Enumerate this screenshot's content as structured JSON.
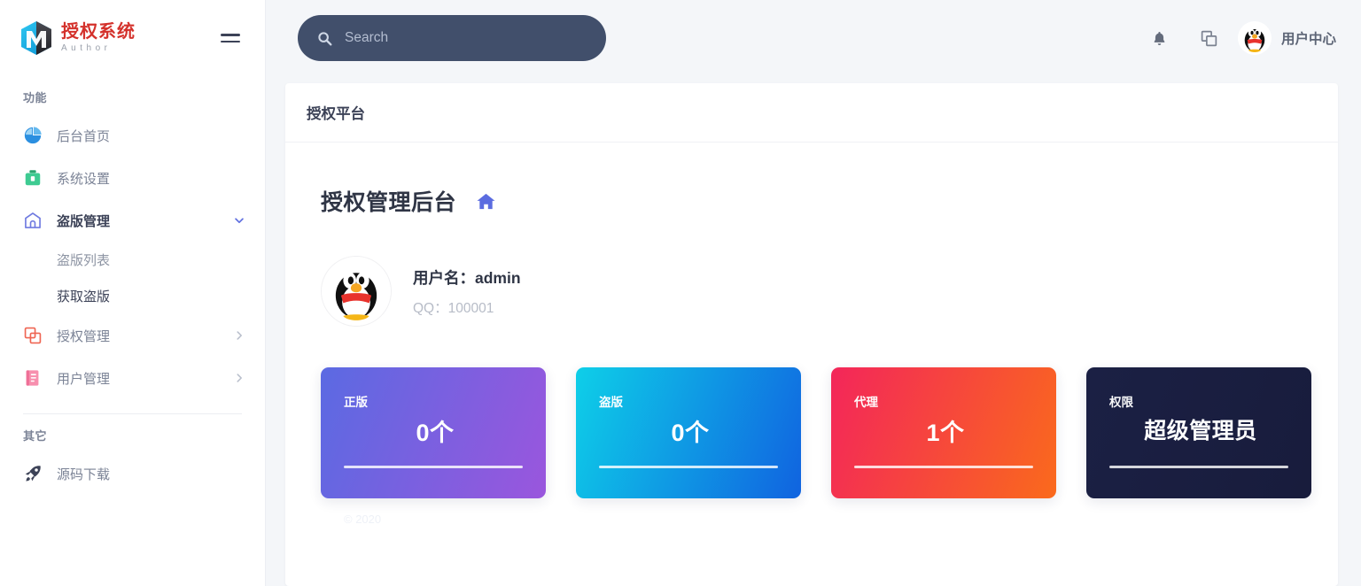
{
  "brand": {
    "title": "授权系统",
    "subtitle": "Author",
    "logo_icon": "cube-m-logo-icon",
    "menu_toggle_icon": "hamburger-icon"
  },
  "sidebar": {
    "sections": [
      {
        "title": "功能"
      },
      {
        "title": "其它"
      }
    ],
    "items": [
      {
        "label": "后台首页",
        "icon": "pie-chart-icon",
        "icon_color": "#2b8fe0",
        "expandable": false
      },
      {
        "label": "系统设置",
        "icon": "toolbox-icon",
        "icon_color": "#37c18a",
        "expandable": false
      },
      {
        "label": "盗版管理",
        "icon": "store-icon",
        "icon_color": "#6f7ae0",
        "expandable": true,
        "expanded": true,
        "active": true
      },
      {
        "label": "授权管理",
        "icon": "copy-squares-icon",
        "icon_color": "#ef6552",
        "expandable": true,
        "expanded": false
      },
      {
        "label": "用户管理",
        "icon": "document-lines-icon",
        "icon_color": "#ef7c9e",
        "expandable": true,
        "expanded": false
      }
    ],
    "subitems": [
      {
        "label": "盗版列表",
        "current": false
      },
      {
        "label": "获取盗版",
        "current": true
      }
    ],
    "other_items": [
      {
        "label": "源码下载",
        "icon": "rocket-icon",
        "icon_color": "#3c4257"
      }
    ],
    "caret_down_icon": "chevron-down-icon",
    "caret_right_icon": "chevron-right-icon"
  },
  "topbar": {
    "search": {
      "placeholder": "Search",
      "value": "",
      "icon": "search-icon"
    },
    "notification_icon": "bell-icon",
    "windows_icon": "copy-windows-icon",
    "avatar_icon": "qq-penguin-avatar-icon",
    "user_center_label": "用户中心"
  },
  "panel": {
    "header_title": "授权平台",
    "dashboard_title": "授权管理后台",
    "home_icon": "home-icon",
    "user": {
      "avatar_icon": "qq-penguin-avatar-icon",
      "name_label": "用户名：",
      "name_value": "admin",
      "qq_label": "QQ：",
      "qq_value": "100001"
    },
    "cards": [
      {
        "label": "正版",
        "value": "0个",
        "gradient_from": "#5b6ae2",
        "gradient_to": "#9a56dd"
      },
      {
        "label": "盗版",
        "value": "0个",
        "gradient_from": "#0ecfe8",
        "gradient_to": "#1063e0"
      },
      {
        "label": "代理",
        "value": "1个",
        "gradient_from": "#f3265a",
        "gradient_to": "#fa6a1c"
      },
      {
        "label": "权限",
        "value": "超级管理员",
        "gradient_from": "#1b2044",
        "gradient_to": "#181c3c"
      }
    ],
    "footer": "© 2020"
  },
  "colors": {
    "page_bg": "#f4f6f9",
    "sidebar_bg": "#ffffff",
    "brand_red": "#d4322c",
    "search_bg": "#414f6b",
    "text_dark": "#3c4257",
    "text_muted": "#7b8396"
  }
}
